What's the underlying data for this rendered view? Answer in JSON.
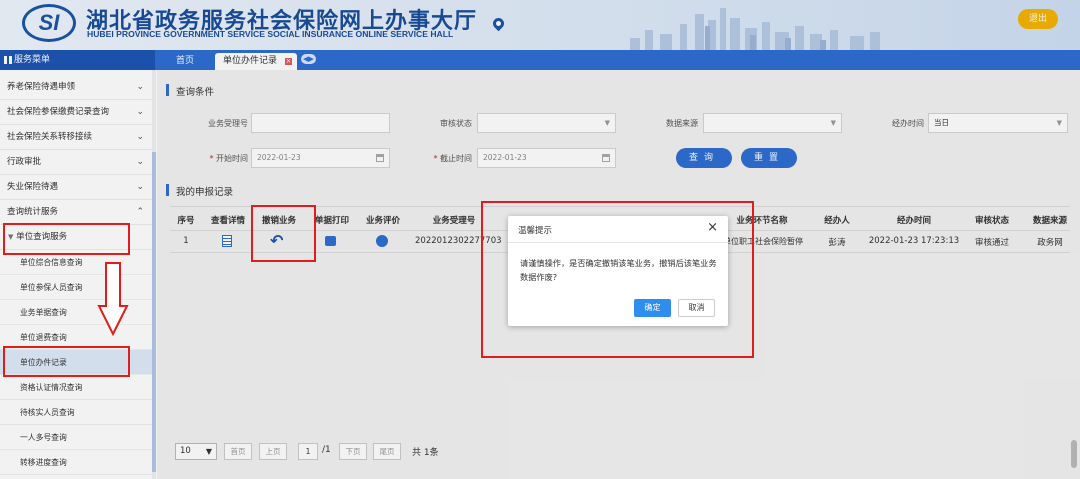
{
  "header": {
    "logo_text": "SI",
    "title_cn": "湖北省政务服务社会保险网上办事大厅",
    "title_en": "HUBEI PROVINCE GOVERNMENT SERVICE SOCIAL INSURANCE ONLINE SERVICE HALL",
    "logout_label": "退出"
  },
  "menu_title": "服务菜单",
  "tabs": [
    {
      "label": "首页"
    },
    {
      "label": "单位办件记录"
    }
  ],
  "sidebar": {
    "items": [
      {
        "label": "养老保险待遇申领"
      },
      {
        "label": "社会保险参保缴费记录查询"
      },
      {
        "label": "社会保险关系转移接续"
      },
      {
        "label": "行政审批"
      },
      {
        "label": "失业保险待遇"
      },
      {
        "label": "查询统计服务"
      }
    ],
    "group_label": "单位查询服务",
    "sub_items": [
      {
        "label": "单位综合信息查询"
      },
      {
        "label": "单位参保人员查询"
      },
      {
        "label": "业务单据查询"
      },
      {
        "label": "单位退费查询"
      },
      {
        "label": "单位办件记录"
      },
      {
        "label": "资格认证情况查询"
      },
      {
        "label": "待核实人员查询"
      },
      {
        "label": "一人多号查询"
      },
      {
        "label": "转移进度查询"
      }
    ]
  },
  "query": {
    "section_title": "查询条件",
    "fields": {
      "biz_no_label": "业务受理号",
      "audit_status_label": "审核状态",
      "data_source_label": "数据来源",
      "handle_time_label": "经办时间",
      "handle_time_value": "当日",
      "start_time_label": "开始时间",
      "start_time_value": "2022-01-23",
      "end_time_label": "截止时间",
      "end_time_value": "2022-01-23"
    },
    "search_label": "查询",
    "reset_label": "重置"
  },
  "records": {
    "section_title": "我的申报记录",
    "columns": [
      "序号",
      "查看详情",
      "撤销业务",
      "单据打印",
      "业务评价",
      "业务受理号",
      "业务环节名称",
      "经办人",
      "经办时间",
      "审核状态",
      "数据来源"
    ],
    "rows": [
      {
        "index": "1",
        "biz_no": "2022012302277703",
        "step": "单位职工社会保险暂停",
        "handler": "彭涛",
        "time": "2022-01-23 17:23:13",
        "status": "审核通过",
        "source": "政务网"
      }
    ]
  },
  "pager": {
    "page_size": "10",
    "first": "首页",
    "prev": "上页",
    "current": "1",
    "total_pages": "/1",
    "next": "下页",
    "last": "尾页",
    "total_text": "共 1条"
  },
  "dialog": {
    "title": "温馨提示",
    "message": "请谨慎操作，是否确定撤销该笔业务，撤销后该笔业务数据作废?",
    "ok_label": "确定",
    "cancel_label": "取消"
  },
  "colors": {
    "primary": "#2e6ed3",
    "highlight": "#e21b1b",
    "logout": "#f5b400"
  }
}
